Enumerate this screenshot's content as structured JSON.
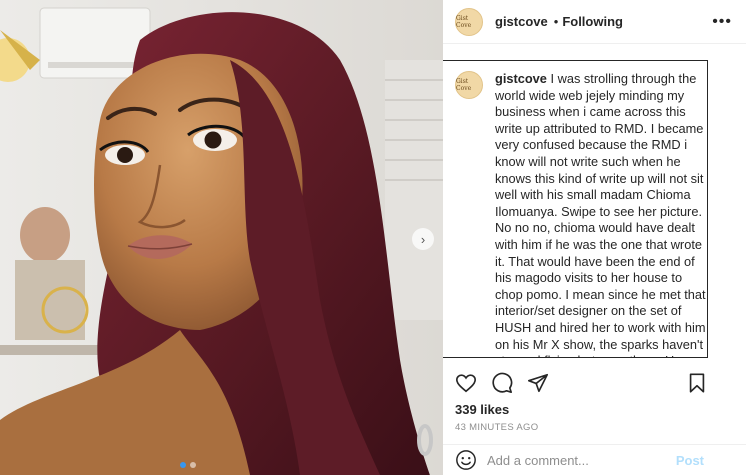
{
  "post": {
    "username": "gistcove",
    "separator": "•",
    "follow_status": "Following",
    "more_icon": "•••",
    "avatar_text": "Gist Cove"
  },
  "photo": {
    "next_arrow": "›"
  },
  "caption": {
    "username": "gistcove",
    "paragraph1": "I was strolling through the world wide web jejely minding my business when i came across this write up attributed to RMD. I became very confused because the RMD i know will not write such when he knows this kind of write up will not sit well with his small madam Chioma Ilomuanya. Swipe to see her picture.",
    "paragraph2": "No no no, chioma would have dealt with him if he was the one that wrote it. That would have been the end of his magodo visits to her house to chop pomo. I mean since he met that interior/set designer on the set of HUSH and hired her to work with him on his Mr X show, the sparks haven't stopped flying between them. He rented her a shop off allen then and was even there at the store opening"
  },
  "engagement": {
    "likes": "339 likes",
    "time": "43 MINUTES AGO"
  },
  "comment_box": {
    "placeholder": "Add a comment...",
    "post_label": "Post"
  },
  "colors": {
    "accent": "#3897f0",
    "post_disabled": "#b2dffc",
    "hair": "#5a1a24"
  }
}
